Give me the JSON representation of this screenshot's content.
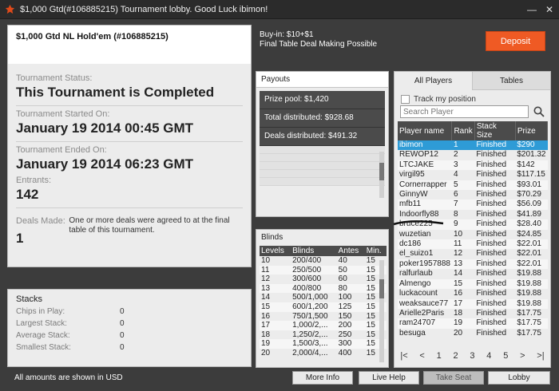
{
  "window": {
    "title": "$1,000 Gtd(#106885215) Tournament lobby. Good Luck ibimon!",
    "minimize": "—",
    "close": "✕"
  },
  "left": {
    "header": "$1,000 Gtd NL Hold'em (#106885215)",
    "status_label": "Tournament Status:",
    "status_value": "This Tournament is Completed",
    "started_label": "Tournament Started On:",
    "started_value": "January 19 2014  00:45 GMT",
    "ended_label": "Tournament Ended On:",
    "ended_value": "January 19 2014  06:23 GMT",
    "entrants_label": "Entrants:",
    "entrants_value": "142",
    "deals_label": "Deals Made:",
    "deals_value": "1",
    "deals_note": "One or more deals were agreed to at the final table of this tournament."
  },
  "buyin": {
    "line1": "Buy-in: $10+$1",
    "line2": "Final Table Deal Making Possible"
  },
  "deposit_label": "Deposit",
  "payouts": {
    "title": "Payouts",
    "rows": [
      "Prize pool: $1,420",
      "Total distributed: $928.68",
      "Deals distributed: $491.32"
    ]
  },
  "blinds": {
    "title": "Blinds",
    "headers": [
      "Levels",
      "Blinds",
      "Antes",
      "Min."
    ],
    "rows": [
      [
        "10",
        "200/400",
        "40",
        "15"
      ],
      [
        "11",
        "250/500",
        "50",
        "15"
      ],
      [
        "12",
        "300/600",
        "60",
        "15"
      ],
      [
        "13",
        "400/800",
        "80",
        "15"
      ],
      [
        "14",
        "500/1,000",
        "100",
        "15"
      ],
      [
        "15",
        "600/1,200",
        "125",
        "15"
      ],
      [
        "16",
        "750/1,500",
        "150",
        "15"
      ],
      [
        "17",
        "1,000/2,...",
        "200",
        "15"
      ],
      [
        "18",
        "1,250/2,...",
        "250",
        "15"
      ],
      [
        "19",
        "1,500/3,...",
        "300",
        "15"
      ],
      [
        "20",
        "2,000/4,...",
        "400",
        "15"
      ]
    ]
  },
  "players": {
    "tab_all": "All Players",
    "tab_tables": "Tables",
    "track_label": "Track my position",
    "search_placeholder": "Search Player",
    "headers": [
      "Player name",
      "Rank",
      "Stack Size",
      "Prize"
    ],
    "rows": [
      [
        "ibimon",
        "1",
        "Finished",
        "$290"
      ],
      [
        "REWOP12",
        "2",
        "Finished",
        "$201.32"
      ],
      [
        "LTCJAKE",
        "3",
        "Finished",
        "$142"
      ],
      [
        "virgil95",
        "4",
        "Finished",
        "$117.15"
      ],
      [
        "Cornerrapper",
        "5",
        "Finished",
        "$93.01"
      ],
      [
        "GinnyW",
        "6",
        "Finished",
        "$70.29"
      ],
      [
        "mfb11",
        "7",
        "Finished",
        "$56.09"
      ],
      [
        "Indoorfly88",
        "8",
        "Finished",
        "$41.89"
      ],
      [
        "bruce225",
        "9",
        "Finished",
        "$28.40"
      ],
      [
        "wuzetian",
        "10",
        "Finished",
        "$24.85"
      ],
      [
        "dc186",
        "11",
        "Finished",
        "$22.01"
      ],
      [
        "el_suizo1",
        "12",
        "Finished",
        "$22.01"
      ],
      [
        "poker1957888",
        "13",
        "Finished",
        "$22.01"
      ],
      [
        "ralfurlaub",
        "14",
        "Finished",
        "$19.88"
      ],
      [
        "Almengo",
        "15",
        "Finished",
        "$19.88"
      ],
      [
        "luckacount",
        "16",
        "Finished",
        "$19.88"
      ],
      [
        "weaksauce77",
        "17",
        "Finished",
        "$19.88"
      ],
      [
        "Arielle2Paris",
        "18",
        "Finished",
        "$17.75"
      ],
      [
        "ram24707",
        "19",
        "Finished",
        "$17.75"
      ],
      [
        "besuga",
        "20",
        "Finished",
        "$17.75"
      ]
    ],
    "pager": [
      "|<",
      "<",
      "1",
      "2",
      "3",
      "4",
      "5",
      ">",
      ">|"
    ]
  },
  "stacks": {
    "title": "Stacks",
    "rows": [
      {
        "label": "Chips in Play:",
        "value": "0"
      },
      {
        "label": "Largest Stack:",
        "value": "0"
      },
      {
        "label": "Average Stack:",
        "value": "0"
      },
      {
        "label": "Smallest Stack:",
        "value": "0"
      }
    ]
  },
  "footer": {
    "note": "All amounts are shown in USD",
    "more_info": "More Info",
    "live_help": "Live Help",
    "take_seat": "Take Seat",
    "lobby": "Lobby"
  },
  "colors": {
    "accent": "#ef5a24",
    "selected_row": "#2e9bd6",
    "header_dark": "#4b4b4b"
  }
}
